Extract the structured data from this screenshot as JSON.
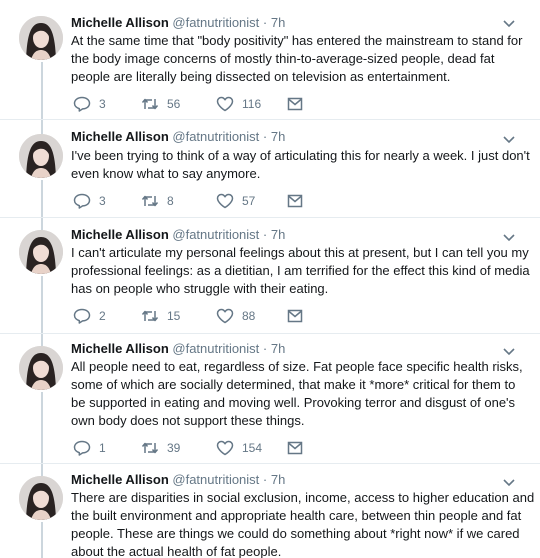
{
  "author": {
    "name": "Michelle Allison",
    "handle": "@fatnutritionist",
    "separator": "·"
  },
  "tweets": [
    {
      "time": "7h",
      "lines": [
        "At the same time that \"body positivity\" has entered the mainstream to stand for",
        "the body image concerns of mostly thin-to-average-sized people, dead fat",
        "people are literally being dissected on television as entertainment."
      ],
      "replies": "3",
      "retweets": "56",
      "likes": "116"
    },
    {
      "time": "7h",
      "lines": [
        "I've been trying to think of a way of articulating this for nearly a week. I just don't",
        "even know what to say anymore."
      ],
      "replies": "3",
      "retweets": "8",
      "likes": "57"
    },
    {
      "time": "7h",
      "lines": [
        "I can't articulate my personal feelings about this at present, but I can tell you my",
        "professional feelings: as a dietitian, I am terrified for the effect this kind of media",
        "has on people who struggle with their eating."
      ],
      "replies": "2",
      "retweets": "15",
      "likes": "88"
    },
    {
      "time": "7h",
      "lines": [
        "All people need to eat, regardless of size. Fat people face specific health risks,",
        "some of which are socially determined, that make it *more* critical for them to",
        "be supported in eating and moving well. Provoking terror and disgust of one's",
        "own body does not support these things."
      ],
      "replies": "1",
      "retweets": "39",
      "likes": "154"
    },
    {
      "time": "7h",
      "lines": [
        "There are disparities in social exclusion, income, access to higher education and",
        "the built environment and appropriate health care, between thin people and fat",
        "people. These are things we could do something about *right now* if we cared",
        "about the actual health of fat people."
      ]
    }
  ],
  "colors": {
    "text": "#14171a",
    "muted": "#657786",
    "divider": "#e6ecf0",
    "thread": "#ccd6dd"
  },
  "icons": [
    "reply-icon",
    "retweet-icon",
    "like-icon",
    "direct-message-icon",
    "chevron-down-icon"
  ]
}
